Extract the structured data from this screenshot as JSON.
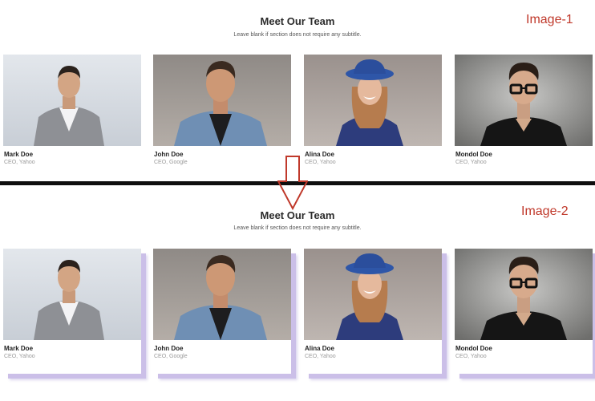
{
  "image1": {
    "tag": "Image-1",
    "title": "Meet Our Team",
    "subtitle": "Leave blank if section does not require any subtitle."
  },
  "image2": {
    "tag": "Image-2",
    "title": "Meet Our Team",
    "subtitle": "Leave blank if section does not require any subtitle."
  },
  "members": [
    {
      "name": "Mark Doe",
      "role": "CEO, Yahoo"
    },
    {
      "name": "John Doe",
      "role": "CEO, Google"
    },
    {
      "name": "Alina Doe",
      "role": "CEO, Yahoo"
    },
    {
      "name": "Mondol Doe",
      "role": "CEO, Yahoo"
    }
  ],
  "colors": {
    "annotation": "#c0392b",
    "shadow": "#cbbfe8",
    "divider": "#0f0f0f"
  }
}
